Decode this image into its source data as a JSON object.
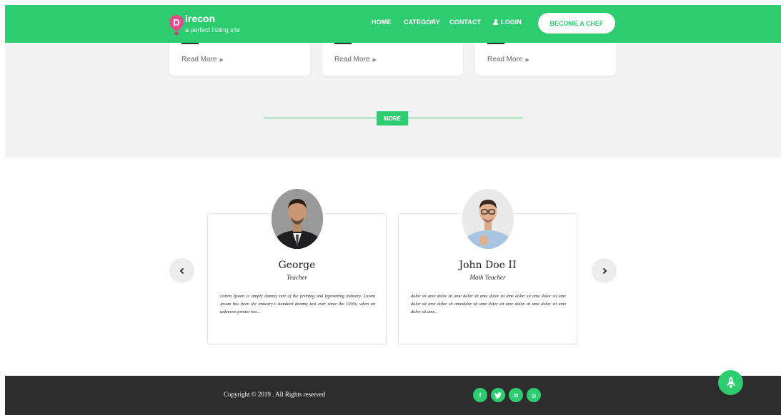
{
  "header": {
    "logo_letter": "D",
    "logo_name": "irecon",
    "logo_tagline": "a perfect listing site",
    "nav": {
      "home": "HOME",
      "category": "CATEGORY",
      "contact": "CONTACT",
      "login": "LOGIN"
    },
    "cta_label": "BECOME A CHEF",
    "brand_color": "#2ecc71"
  },
  "listings": {
    "cards": [
      {
        "read_more": "Read More"
      },
      {
        "read_more": "Read More"
      },
      {
        "read_more": "Read More"
      }
    ],
    "more_label": "MORE"
  },
  "team": {
    "members": [
      {
        "name": "George",
        "role": "Teacher",
        "bio": "Lorem Ipsum is simply dummy text of the printing and typesetting industry. Lorem Ipsum has been the industry's standard dummy text ever since the 1500s, when an unknown printer too..."
      },
      {
        "name": "John Doe II",
        "role": "Math Teacher",
        "bio": "dolor sit ame dolor sit ame dolor sit ame dolor sit ame dolor sit ame dolor sit ame dolor sit ame dolor sit amedolor sit ame dolor sit ame dolor sit ame dolor sit ame dolor sit ame..."
      }
    ]
  },
  "footer": {
    "copyright": "Copyright © 2019 . All Rights reserved",
    "social": [
      {
        "icon": "facebook-icon",
        "glyph": "f"
      },
      {
        "icon": "twitter-icon",
        "glyph": "t"
      },
      {
        "icon": "linkedin-icon",
        "glyph": "in"
      },
      {
        "icon": "instagram-icon",
        "glyph": "◎"
      }
    ]
  }
}
